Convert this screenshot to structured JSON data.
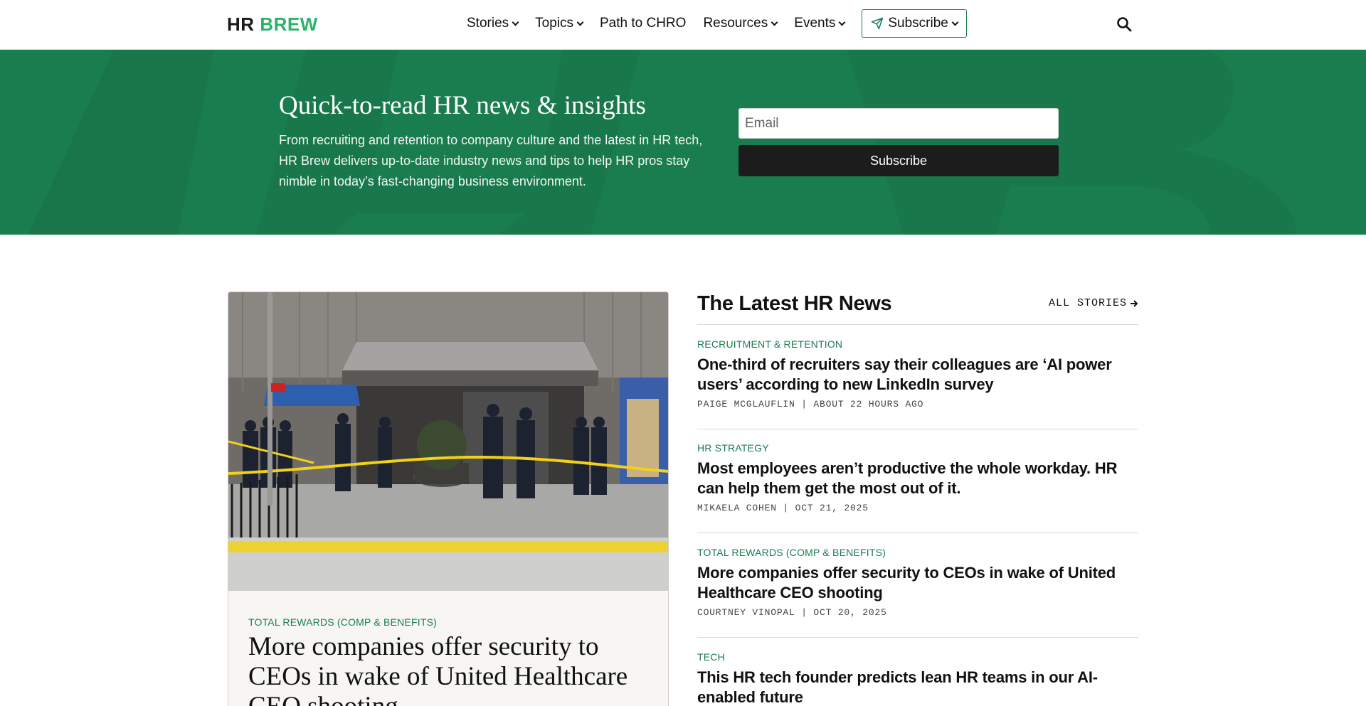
{
  "nav": {
    "logo_hr": "HR",
    "logo_brew": "BREW",
    "items": [
      {
        "label": "Stories",
        "has_dropdown": true
      },
      {
        "label": "Topics",
        "has_dropdown": true
      },
      {
        "label": "Path to CHRO",
        "has_dropdown": false
      },
      {
        "label": "Resources",
        "has_dropdown": true
      },
      {
        "label": "Events",
        "has_dropdown": true
      }
    ],
    "subscribe_label": "Subscribe",
    "search_icon": "search-icon"
  },
  "hero": {
    "title": "Quick-to-read HR news & insights",
    "description": "From recruiting and retention to company culture and the latest in HR tech, HR Brew delivers up-to-date industry news and tips to help HR pros stay nimble in today’s fast-changing business environment.",
    "email_placeholder": "Email",
    "subscribe_button": "Subscribe",
    "background_color": "#1a7d4f"
  },
  "feature": {
    "category": "TOTAL REWARDS (COMP & BENEFITS)",
    "title": "More companies offer security to CEOs in wake of United Healthcare CEO shooting"
  },
  "latest": {
    "heading": "The Latest HR News",
    "all_stories": "ALL STORIES",
    "stories": [
      {
        "category": "RECRUITMENT & RETENTION",
        "title": "One-third of recruiters say their colleagues are ‘AI power users’ according to new LinkedIn survey",
        "meta": "PAIGE MCGLAUFLIN | ABOUT 22 HOURS AGO"
      },
      {
        "category": "HR STRATEGY",
        "title": "Most employees aren’t productive the whole workday. HR can help them get the most out of it.",
        "meta": "MIKAELA COHEN | OCT 21, 2025"
      },
      {
        "category": "TOTAL REWARDS (COMP & BENEFITS)",
        "title": "More companies offer security to CEOs in wake of United Healthcare CEO shooting",
        "meta": "COURTNEY VINOPAL | OCT 20, 2025"
      },
      {
        "category": "TECH",
        "title": "This HR tech founder predicts lean HR teams in our AI-enabled future",
        "meta": ""
      }
    ]
  },
  "colors": {
    "brand_green": "#1a7d4f",
    "logo_green": "#2bb36a"
  }
}
